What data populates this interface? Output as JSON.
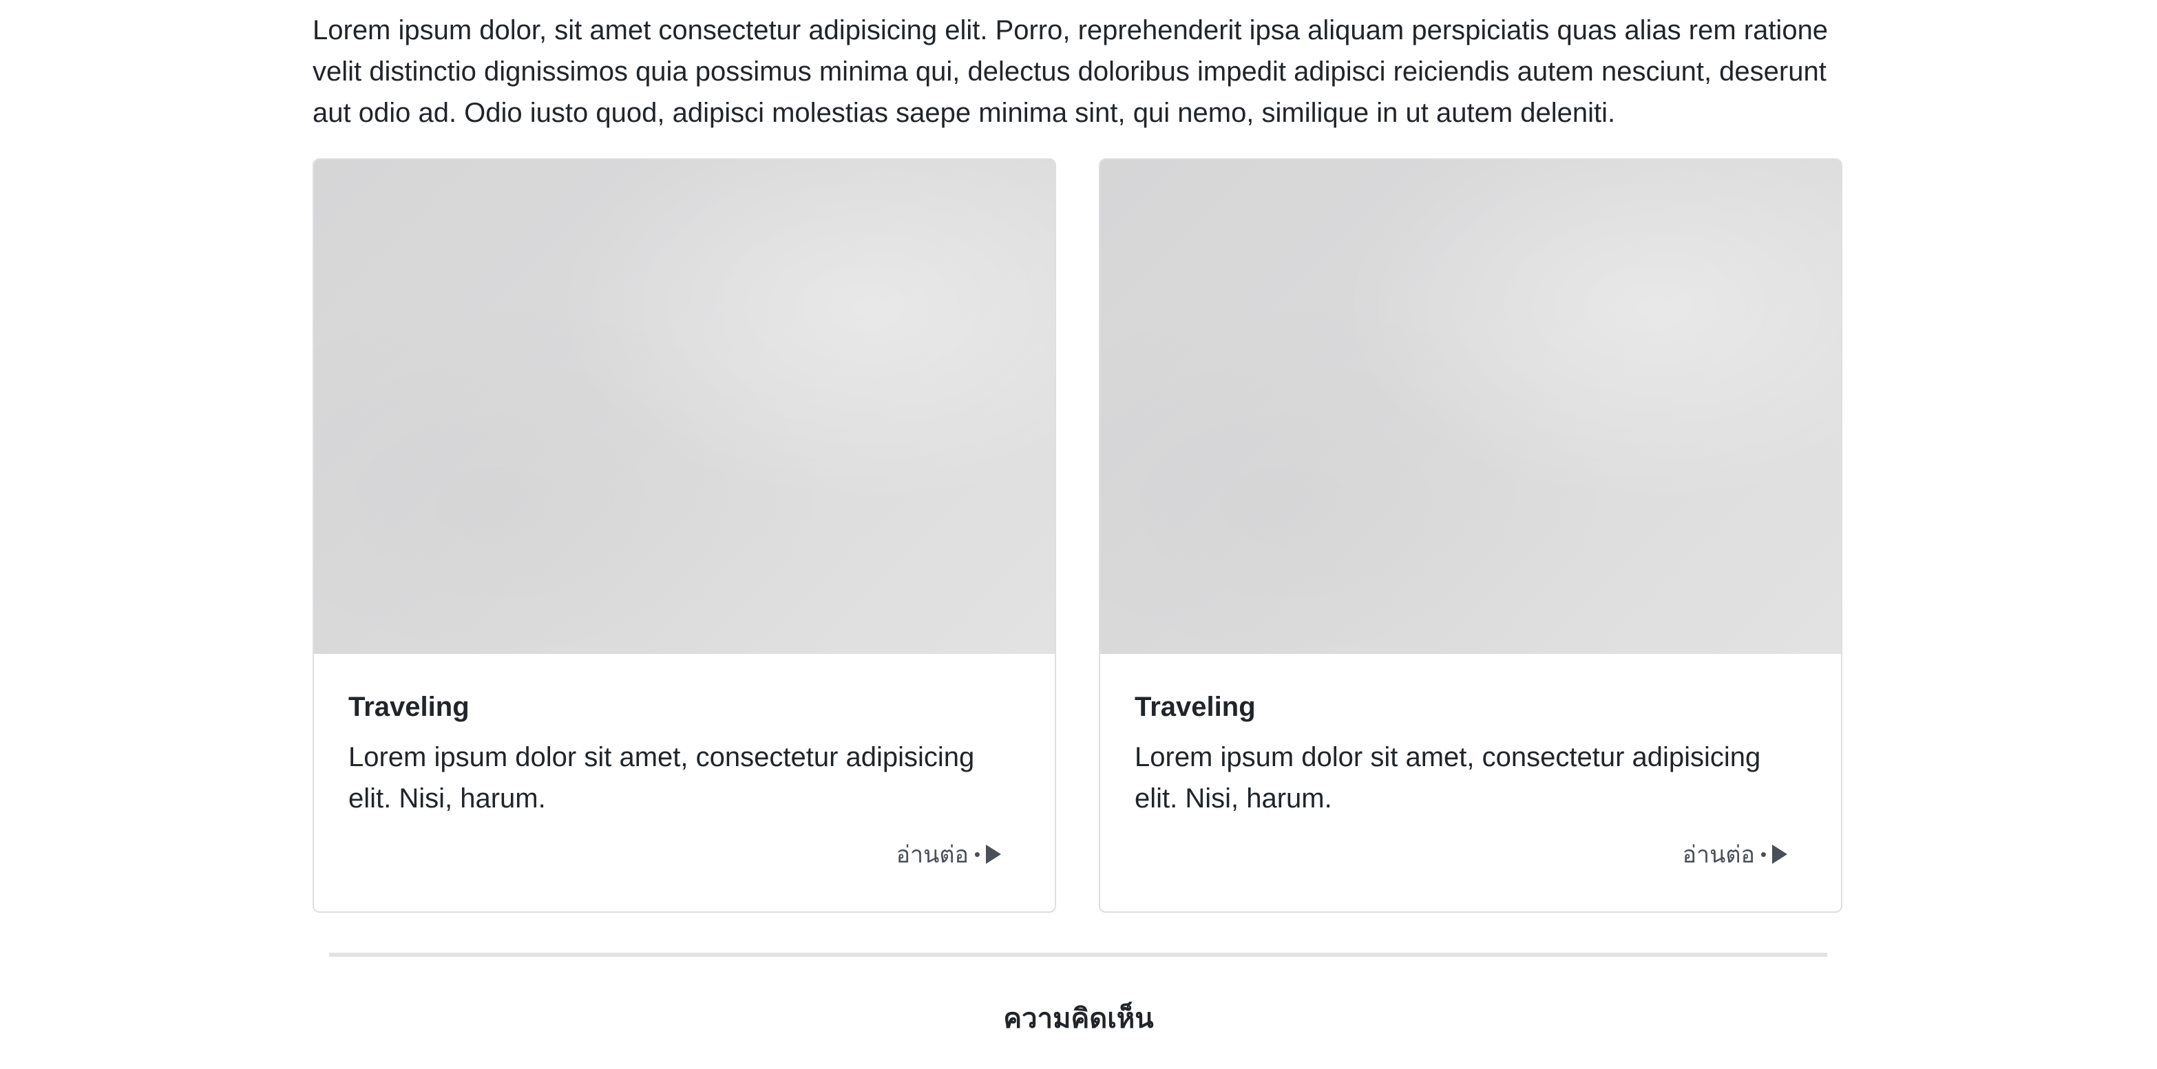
{
  "intro": {
    "text": "Lorem ipsum dolor, sit amet consectetur adipisicing elit. Porro, reprehenderit ipsa aliquam perspiciatis quas alias rem ratione velit distinctio dignissimos quia possimus minima qui, delectus doloribus impedit adipisci reiciendis autem nesciunt, deserunt aut odio ad. Odio iusto quod, adipisci molestias saepe minima sint, qui nemo, similique in ut autem deleniti."
  },
  "cards": [
    {
      "title": "Traveling",
      "text": "Lorem ipsum dolor sit amet, consectetur adipisicing elit. Nisi, harum.",
      "read_more": "อ่านต่อ",
      "bullet": "•",
      "icon": "play-icon"
    },
    {
      "title": "Traveling",
      "text": "Lorem ipsum dolor sit amet, consectetur adipisicing elit. Nisi, harum.",
      "read_more": "อ่านต่อ",
      "bullet": "•",
      "icon": "play-icon"
    }
  ],
  "comments": {
    "title": "ความคิดเห็น"
  },
  "colors": {
    "text": "#212529",
    "muted": "#4a4f58",
    "card_border": "#dcdfe3",
    "divider": "#e2e3e5",
    "image_placeholder": "#dadadb"
  }
}
